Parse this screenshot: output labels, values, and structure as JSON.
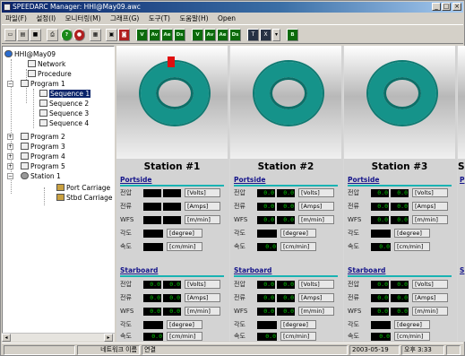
{
  "title": "SPEEDARC Manager: HHI@May09.awc",
  "menu": [
    "파일(F)",
    "설정(I)",
    "모니터링(M)",
    "그래프(G)",
    "도구(T)",
    "도움말(H)",
    "Open"
  ],
  "toolbar": {
    "icons": [
      "new-icon",
      "open-icon",
      "save-icon",
      "print-icon",
      "help-icon",
      "stop-icon",
      "network-icon",
      "image-icon",
      "record-icon"
    ],
    "green_buttons": [
      "V",
      "Av",
      "Ae",
      "Ds",
      "V",
      "Av",
      "Ae",
      "Ds"
    ],
    "dropdown_value": "T",
    "x_label": "X",
    "last_button": "B"
  },
  "tree": {
    "root": "HHI@May09",
    "network": "Network",
    "procedure": "Procedure",
    "program1": "Program 1",
    "sequences": [
      "Sequence 1",
      "Sequence 2",
      "Sequence 3",
      "Sequence 4"
    ],
    "program2": "Program 2",
    "program3": "Program 3",
    "program4": "Program 4",
    "program5": "Program 5",
    "station1": "Station 1",
    "port_carriage": "Port Carriage",
    "stbd_carriage": "Stbd Carriage"
  },
  "stations": [
    {
      "name": "Station #1",
      "portside": {
        "label": "Portside",
        "voltage": [
          "",
          ""
        ],
        "current": [
          "",
          ""
        ],
        "wfs": [
          "",
          ""
        ],
        "angle": "",
        "speed": ""
      },
      "starboard": {
        "label": "Starboard",
        "voltage": [
          "0.0",
          "0.0"
        ],
        "current": [
          "0.0",
          "0.0"
        ],
        "wfs": [
          "0.0",
          "0.0"
        ],
        "angle": "",
        "speed": "0.0"
      }
    },
    {
      "name": "Station #2",
      "portside": {
        "label": "Portside",
        "voltage": [
          "0.0",
          "0.0"
        ],
        "current": [
          "0.0",
          "0.0"
        ],
        "wfs": [
          "0.0",
          "0.0"
        ],
        "angle": "",
        "speed": "0.0"
      },
      "starboard": {
        "label": "Starboard",
        "voltage": [
          "0.0",
          "0.0"
        ],
        "current": [
          "0.0",
          "0.0"
        ],
        "wfs": [
          "0.0",
          "0.0"
        ],
        "angle": "",
        "speed": "0.0"
      }
    },
    {
      "name": "Station #3",
      "portside": {
        "label": "Portside",
        "voltage": [
          "0.0",
          "0.0"
        ],
        "current": [
          "0.0",
          "0.0"
        ],
        "wfs": [
          "0.0",
          "0.0"
        ],
        "angle": "",
        "speed": "0.0"
      },
      "starboard": {
        "label": "Starboard",
        "voltage": [
          "0.0",
          "0.0"
        ],
        "current": [
          "0.0",
          "0.0"
        ],
        "wfs": [
          "0.0",
          "0.0"
        ],
        "angle": "",
        "speed": "0.0"
      }
    }
  ],
  "labels": {
    "voltage": "전압",
    "current": "전류",
    "wfs": "WFS",
    "angle": "각도",
    "speed": "속도",
    "u_voltage": "[Volts]",
    "u_current": "[Amps]",
    "u_wfs": "[m/min]",
    "u_angle": "[degree]",
    "u_speed": "[cm/min]"
  },
  "partial_station": {
    "name": "S",
    "portside": "P",
    "starboard": "S"
  },
  "status": {
    "network_name": "네트워크 이름",
    "connection": "연결",
    "date": "2003-05-19",
    "time": "오후 3:33"
  },
  "colors": {
    "ring": "#15938a",
    "marker": "#e01010",
    "readout_text": "#00c800",
    "title_start": "#0a246a",
    "accent_line": "#19b3b3"
  }
}
